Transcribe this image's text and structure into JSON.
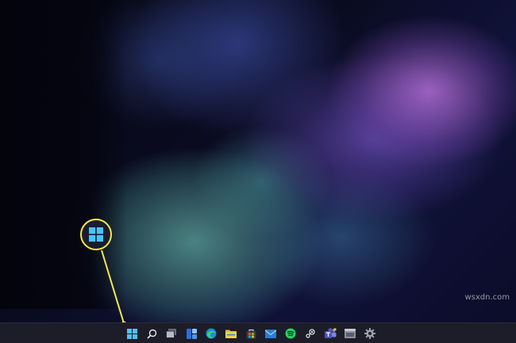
{
  "watermark": "wsxdn.com",
  "colors": {
    "callout": "#f5e94a",
    "taskbar_bg": "#1c1d28",
    "windows_blue": "#4cc2ff"
  },
  "taskbar": {
    "items": [
      {
        "name": "start",
        "icon": "windows-logo-icon"
      },
      {
        "name": "search",
        "icon": "search-icon"
      },
      {
        "name": "task-view",
        "icon": "task-view-icon"
      },
      {
        "name": "widgets",
        "icon": "widgets-icon"
      },
      {
        "name": "edge",
        "icon": "edge-icon"
      },
      {
        "name": "file-explorer",
        "icon": "folder-icon"
      },
      {
        "name": "store",
        "icon": "store-icon"
      },
      {
        "name": "mail",
        "icon": "mail-icon"
      },
      {
        "name": "spotify",
        "icon": "spotify-icon"
      },
      {
        "name": "steam",
        "icon": "steam-icon"
      },
      {
        "name": "teams",
        "icon": "teams-icon"
      },
      {
        "name": "app-window",
        "icon": "app-window-icon"
      },
      {
        "name": "settings",
        "icon": "gear-icon"
      }
    ]
  },
  "callout": {
    "icon": "windows-logo-icon"
  }
}
